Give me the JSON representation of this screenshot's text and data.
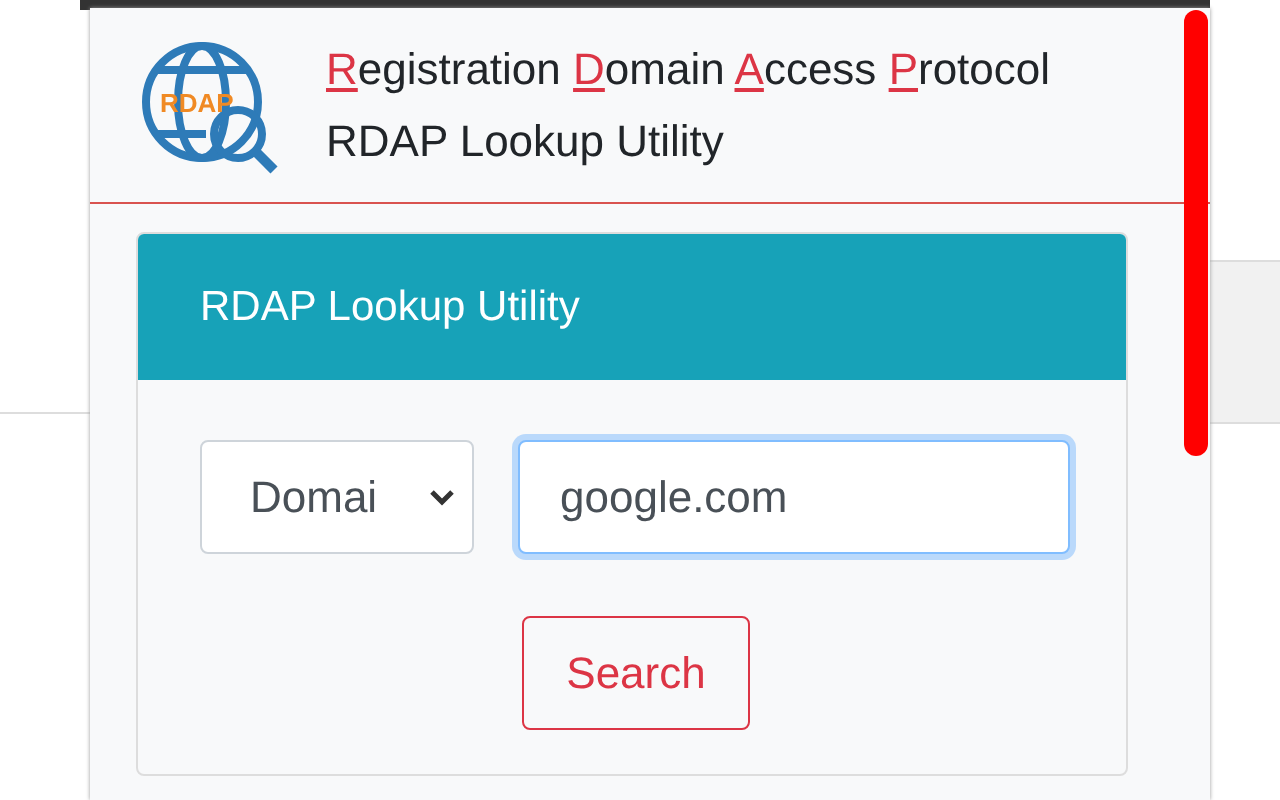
{
  "header": {
    "title_words": [
      "Registration",
      "Domain",
      "Access",
      "Protocol"
    ],
    "subtitle": "RDAP Lookup Utility",
    "logo_text": "RDAP"
  },
  "card": {
    "title": "RDAP Lookup Utility",
    "type_select": {
      "value": "Domai"
    },
    "query_field": {
      "value": "google.com",
      "focused": true
    },
    "search_button": {
      "label": "Search"
    }
  }
}
